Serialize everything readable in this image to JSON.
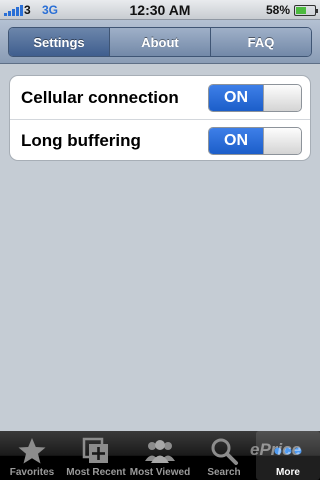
{
  "status_bar": {
    "carrier": "3",
    "network": "3G",
    "time": "12:30 AM",
    "battery_percent": "58%",
    "battery_level": 0.58
  },
  "toolbar": {
    "segments": [
      {
        "label": "Settings",
        "selected": true
      },
      {
        "label": "About",
        "selected": false
      },
      {
        "label": "FAQ",
        "selected": false
      }
    ]
  },
  "settings": {
    "rows": [
      {
        "label": "Cellular connection",
        "toggle": "ON"
      },
      {
        "label": "Long buffering",
        "toggle": "ON"
      }
    ]
  },
  "tab_bar": {
    "items": [
      {
        "label": "Favorites",
        "icon": "star-icon",
        "selected": false
      },
      {
        "label": "Most Recent",
        "icon": "recent-icon",
        "selected": false
      },
      {
        "label": "Most Viewed",
        "icon": "people-icon",
        "selected": false
      },
      {
        "label": "Search",
        "icon": "search-icon",
        "selected": false
      },
      {
        "label": "More",
        "icon": "more-icon",
        "selected": true
      }
    ]
  },
  "watermark": "ePrice",
  "colors": {
    "accent": "#1c5ec9",
    "toolbar": "#8a9cb5",
    "background": "#c5ccd4"
  }
}
